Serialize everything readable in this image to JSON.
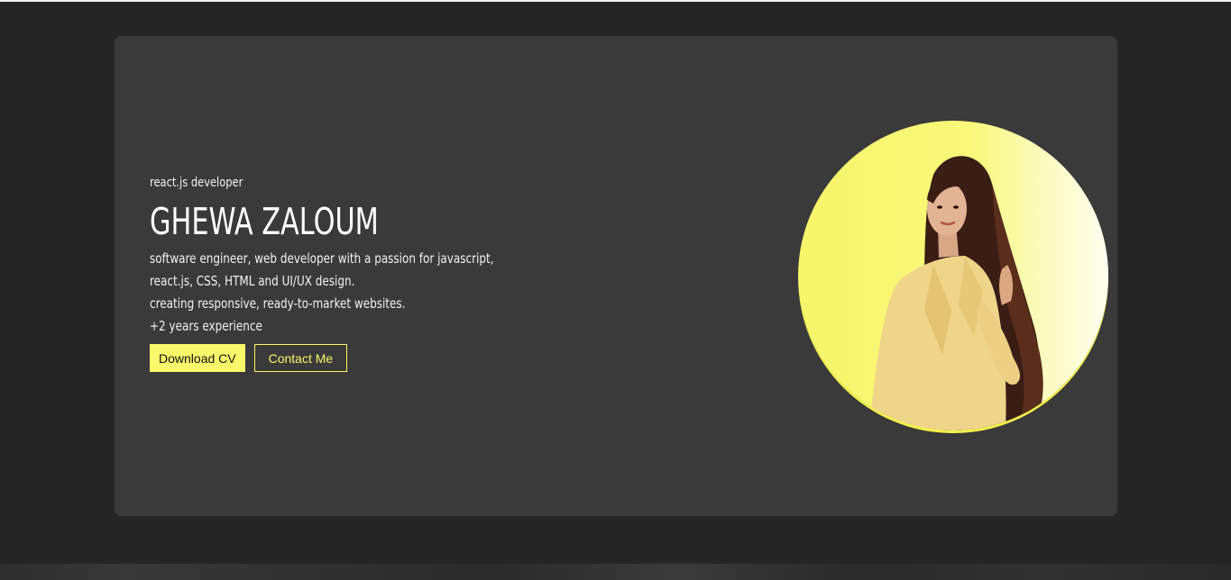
{
  "hero": {
    "role": "react.js developer",
    "name": "GHEWA ZALOUM",
    "description": [
      "software engineer, web developer with a passion for javascript,",
      "react.js, CSS, HTML and UI/UX design.",
      "creating responsive, ready-to-market websites.",
      "+2 years experience"
    ],
    "buttons": {
      "download_cv": "Download CV",
      "contact_me": "Contact Me"
    }
  },
  "colors": {
    "accent": "#f8f86a",
    "card_bg": "#3a3a3a",
    "page_bg": "#252525"
  }
}
